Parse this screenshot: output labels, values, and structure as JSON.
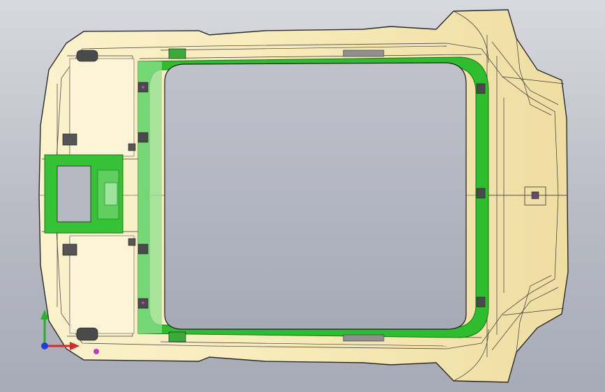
{
  "viewport": {
    "background_top": "#d7d9de",
    "background_bottom": "#a7abb6"
  },
  "model": {
    "shell_color": "#f7eab8",
    "shell_shade_color": "#ecd99c",
    "line_color": "#2a2a2a",
    "frame_color": "#26b826",
    "frame_dark_color": "#138a13",
    "frame_light_color": "#8fe08f",
    "opening_color": "#b1b5c0",
    "clip_color": "#4a4a4a",
    "fastener_color": "#c03cc8"
  },
  "triad": {
    "x_axis_color": "#d62a2a",
    "y_axis_color": "#27b12a",
    "z_axis_color": "#1f3fd6",
    "origin_icon": "axis-triad-icon"
  }
}
